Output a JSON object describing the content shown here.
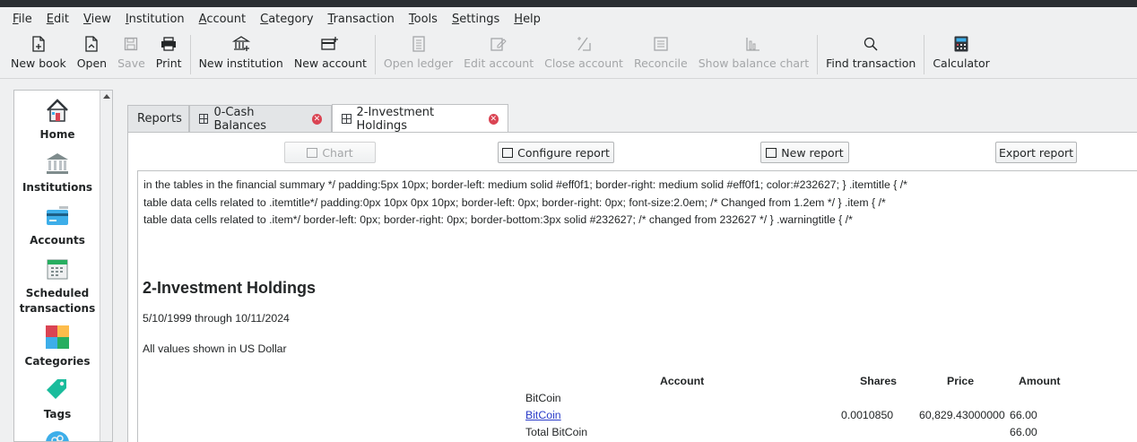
{
  "menu": [
    "File",
    "Edit",
    "View",
    "Institution",
    "Account",
    "Category",
    "Transaction",
    "Tools",
    "Settings",
    "Help"
  ],
  "menu_underline": [
    "F",
    "E",
    "V",
    "I",
    "A",
    "C",
    "T",
    "T",
    "S",
    "H"
  ],
  "toolbar": {
    "new_book": "New book",
    "open": "Open",
    "save": "Save",
    "print": "Print",
    "new_institution": "New institution",
    "new_account": "New account",
    "open_ledger": "Open ledger",
    "edit_account": "Edit account",
    "close_account": "Close account",
    "reconcile": "Reconcile",
    "show_balance_chart": "Show balance chart",
    "find_transaction": "Find transaction",
    "calculator": "Calculator"
  },
  "sidebar": {
    "items": [
      {
        "label": "Home",
        "icon": "home-icon"
      },
      {
        "label": "Institutions",
        "icon": "institution-icon"
      },
      {
        "label": "Accounts",
        "icon": "accounts-icon"
      },
      {
        "label": "Scheduled transactions",
        "icon": "calendar-icon"
      },
      {
        "label": "Categories",
        "icon": "categories-icon"
      },
      {
        "label": "Tags",
        "icon": "tag-icon"
      }
    ]
  },
  "tabs": [
    {
      "label": "Reports"
    },
    {
      "label": "0-Cash Balances"
    },
    {
      "label": "2-Investment Holdings"
    }
  ],
  "report_buttons": {
    "chart": "Chart",
    "configure": "Configure report",
    "new": "New report",
    "export": "Export report"
  },
  "report": {
    "css_lines": [
      "in the tables in the financial summary */ padding:5px 10px; border-left: medium solid #eff0f1; border-right: medium solid #eff0f1; color:#232627; } .itemtitle { /*",
      "table data cells related to .itemtitle*/ padding:0px 10px 0px 10px; border-left: 0px; border-right: 0px; font-size:2.0em; /* Changed from 1.2em */ } .item { /*",
      "table data cells related to .item*/ border-left: 0px; border-right: 0px; border-bottom:3px solid #232627; /*                    changed from 232627 */ } .warningtitle { /*"
    ],
    "title": "2-Investment Holdings",
    "date_range": "5/10/1999 through 10/11/2024",
    "currency_note": "All values shown in US Dollar",
    "columns": {
      "account": "Account",
      "shares": "Shares",
      "price": "Price",
      "amount": "Amount"
    },
    "rows": [
      {
        "account": "BitCoin",
        "shares": "",
        "price": "",
        "amount": ""
      },
      {
        "account": "BitCoin",
        "shares": "0.0010850",
        "price": "60,829.43000000",
        "amount": "66.00"
      },
      {
        "account": "Total BitCoin",
        "shares": "",
        "price": "",
        "amount": "66.00"
      }
    ]
  },
  "colors": {
    "accent": "#3daee9",
    "close_badge": "#da4453",
    "link": "#2a3bc9"
  }
}
